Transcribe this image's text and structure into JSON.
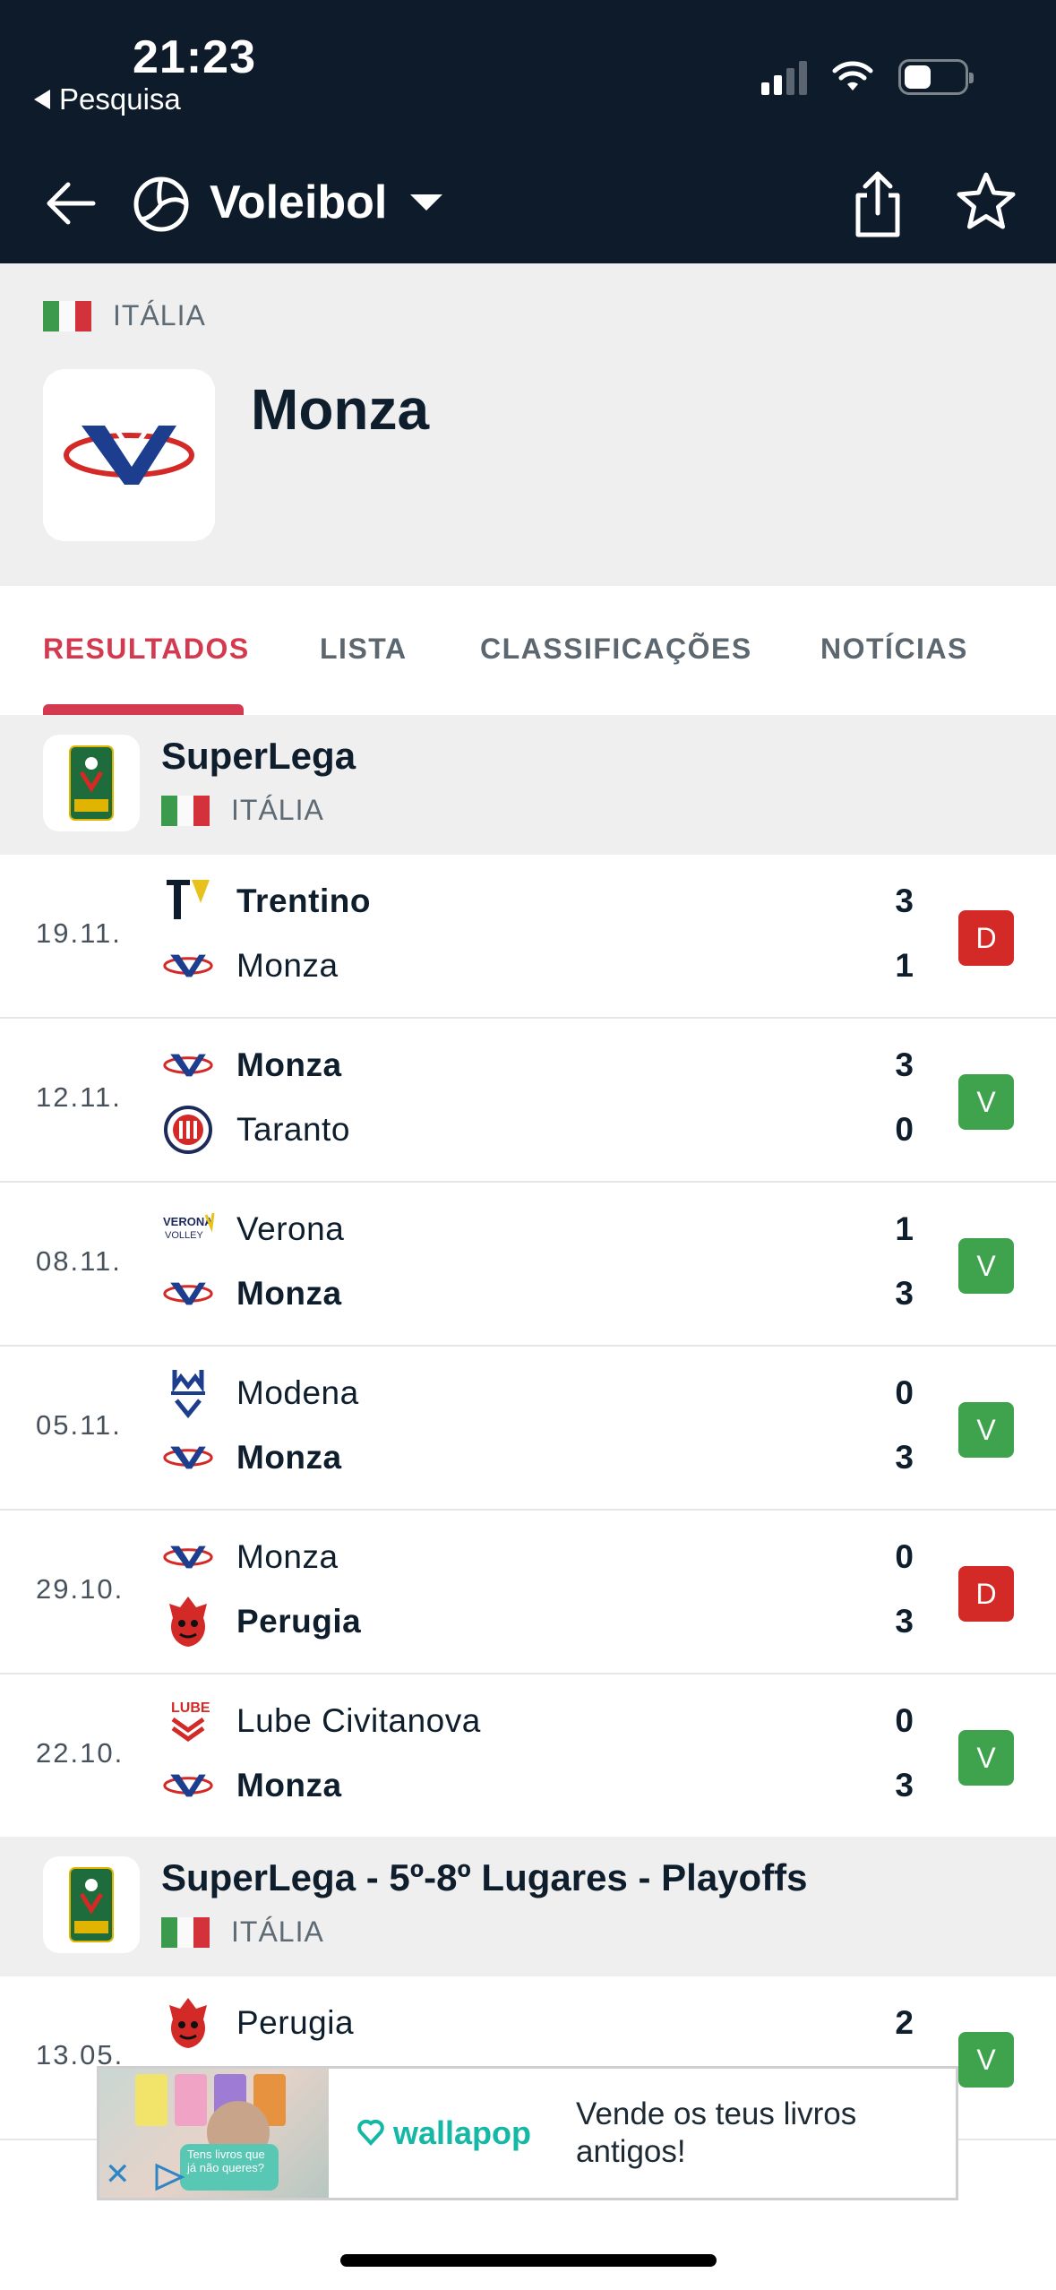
{
  "status_bar": {
    "time": "21:23",
    "back_label": "Pesquisa"
  },
  "nav": {
    "sport": "Voleibol"
  },
  "team": {
    "country": "ITÁLIA",
    "name": "Monza"
  },
  "tabs": [
    {
      "label": "RESULTADOS",
      "active": true
    },
    {
      "label": "LISTA",
      "active": false
    },
    {
      "label": "CLASSIFICAÇÕES",
      "active": false
    },
    {
      "label": "NOTÍCIAS",
      "active": false
    }
  ],
  "competitions": [
    {
      "name": "SuperLega",
      "country": "ITÁLIA"
    },
    {
      "name": "SuperLega - 5º-8º Lugares - Playoffs",
      "country": "ITÁLIA"
    }
  ],
  "matches": [
    {
      "date": "19.11.",
      "home": "Trentino",
      "home_score": "3",
      "away": "Monza",
      "away_score": "1",
      "winner": "home",
      "result": "D",
      "home_icon": "trentino-logo-icon",
      "away_icon": "monza-logo-icon"
    },
    {
      "date": "12.11.",
      "home": "Monza",
      "home_score": "3",
      "away": "Taranto",
      "away_score": "0",
      "winner": "home",
      "result": "V",
      "home_icon": "monza-logo-icon",
      "away_icon": "taranto-logo-icon"
    },
    {
      "date": "08.11.",
      "home": "Verona",
      "home_score": "1",
      "away": "Monza",
      "away_score": "3",
      "winner": "away",
      "result": "V",
      "home_icon": "verona-logo-icon",
      "away_icon": "monza-logo-icon"
    },
    {
      "date": "05.11.",
      "home": "Modena",
      "home_score": "0",
      "away": "Monza",
      "away_score": "3",
      "winner": "away",
      "result": "V",
      "home_icon": "modena-logo-icon",
      "away_icon": "monza-logo-icon"
    },
    {
      "date": "29.10.",
      "home": "Monza",
      "home_score": "0",
      "away": "Perugia",
      "away_score": "3",
      "winner": "away",
      "result": "D",
      "home_icon": "monza-logo-icon",
      "away_icon": "perugia-logo-icon"
    },
    {
      "date": "22.10.",
      "home": "Lube Civitanova",
      "home_score": "0",
      "away": "Monza",
      "away_score": "3",
      "winner": "away",
      "result": "V",
      "home_icon": "lube-logo-icon",
      "away_icon": "monza-logo-icon"
    },
    {
      "date": "13.05.",
      "home": "Perugia",
      "home_score": "2",
      "away": "",
      "away_score": "",
      "winner": "",
      "result": "V",
      "home_icon": "perugia-logo-icon",
      "away_icon": ""
    }
  ],
  "ad": {
    "brand": "wallapop",
    "text": "Vende os teus livros antigos!",
    "image_caption": "Tens livros que já não queres?"
  },
  "colors": {
    "header_bg": "#0d1b2a",
    "accent": "#d43a4f",
    "win": "#3fa34d",
    "loss": "#d32a27"
  }
}
